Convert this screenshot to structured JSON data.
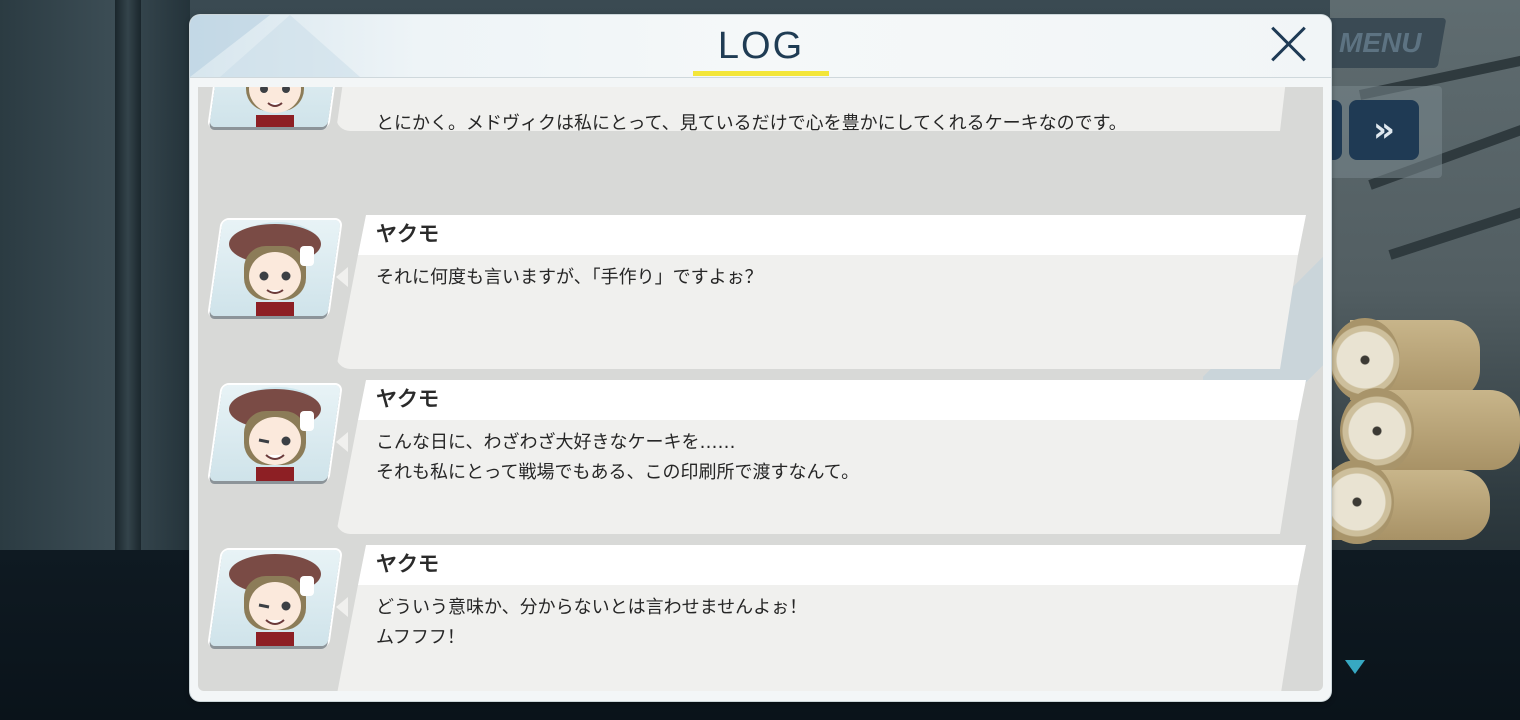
{
  "background": {
    "menu_label": "MENU",
    "skip_icon": "fast-forward-icon"
  },
  "log": {
    "title": "LOG",
    "close_icon": "close-icon",
    "accent_color": "#f3e63a",
    "entries": [
      {
        "speaker": "",
        "lines": [
          "とにかく。メドヴィクは私にとって、見ているだけで心を豊かにしてくれるケーキなのです。"
        ]
      },
      {
        "speaker": "ヤクモ",
        "lines": [
          "それに何度も言いますが、「手作り」ですよぉ？"
        ]
      },
      {
        "speaker": "ヤクモ",
        "lines": [
          "こんな日に、わざわざ大好きなケーキを……",
          "それも私にとって戦場でもある、この印刷所で渡すなんて。"
        ]
      },
      {
        "speaker": "ヤクモ",
        "lines": [
          "どういう意味か、分からないとは言わせませんよぉ！",
          "ムフフフ！"
        ]
      }
    ]
  }
}
